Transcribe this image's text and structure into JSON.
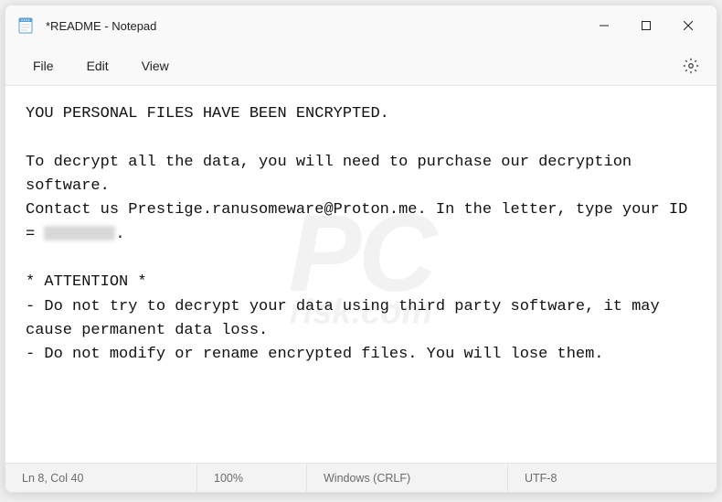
{
  "window": {
    "title": "*README - Notepad"
  },
  "menu": {
    "file": "File",
    "edit": "Edit",
    "view": "View"
  },
  "document": {
    "line1": "YOU PERSONAL FILES HAVE BEEN ENCRYPTED.",
    "line2": "",
    "line3": "To decrypt all the data, you will need to purchase our decryption software.",
    "line4_part1": "Contact us Prestige.ranusomeware@Proton.me. In the letter, type your ID = ",
    "line4_part2": ".",
    "line5": "",
    "line6": "* ATTENTION *",
    "line7": "- Do not try to decrypt your data using third party software, it may cause permanent data loss.",
    "line8": "- Do not modify or rename encrypted files. You will lose them."
  },
  "statusbar": {
    "cursor": "Ln 8, Col 40",
    "zoom": "100%",
    "eol": "Windows (CRLF)",
    "encoding": "UTF-8"
  },
  "watermark": {
    "main": "PC",
    "sub": "risk.com"
  }
}
